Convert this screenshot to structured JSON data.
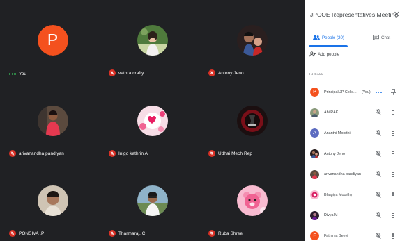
{
  "grid": [
    {
      "name": "You",
      "avatar": "letter",
      "letter": "P",
      "status": "speaking-dots-icon"
    },
    {
      "name": "vethra crafty",
      "avatar": "photo-girl-icon",
      "status": "mic-off-icon"
    },
    {
      "name": "Antony Jeno",
      "avatar": "photo-couple-icon",
      "status": "mic-off-icon"
    },
    {
      "name": "arivanandha pandiyan",
      "avatar": "photo-man-red-shirt-icon",
      "status": "mic-off-icon"
    },
    {
      "name": "Inigo kathrin A",
      "avatar": "photo-pink-hearts-icon",
      "status": "mic-off-icon"
    },
    {
      "name": "Udhai Mech Rep",
      "avatar": "photo-dark-logo-icon",
      "status": "mic-off-icon"
    },
    {
      "name": "PONSIVA .P",
      "avatar": "photo-boy-icon",
      "status": "mic-off-icon"
    },
    {
      "name": "Tharmaraj. C",
      "avatar": "photo-man-outdoor-icon",
      "status": "mic-off-icon"
    },
    {
      "name": "Ruba Shree",
      "avatar": "photo-teddy-bear-icon",
      "status": "mic-off-icon"
    }
  ],
  "panel": {
    "title": "JPCOE Representatives Meeting",
    "tab_people": "People (20)",
    "tab_chat": "Chat",
    "add_people": "Add people",
    "in_call": "IN CALL",
    "you_label": "(You)",
    "participants": [
      {
        "name": "Principal JP Colle...",
        "avatar": "letter",
        "letter": "P",
        "color": "#f4511e"
      },
      {
        "name": "Abi RAK",
        "avatar": "photo-person-icon"
      },
      {
        "name": "Ananthi Moorthi",
        "avatar": "letter",
        "letter": "A",
        "color": "#5c6bc0"
      },
      {
        "name": "Antony Jeno",
        "avatar": "photo-couple-icon"
      },
      {
        "name": "arivanandha pandiyan",
        "avatar": "photo-man-red-shirt-icon"
      },
      {
        "name": "Bhagiya Moorthy",
        "avatar": "photo-pink-icon"
      },
      {
        "name": "Divya M",
        "avatar": "photo-dark-icon"
      },
      {
        "name": "Fathima Beevi",
        "avatar": "letter",
        "letter": "F",
        "color": "#f4511e"
      }
    ]
  },
  "colors": {
    "stage_bg": "#202124",
    "mic_off": "#d93025",
    "accent": "#1a73e8",
    "speaking": "#34a853"
  }
}
